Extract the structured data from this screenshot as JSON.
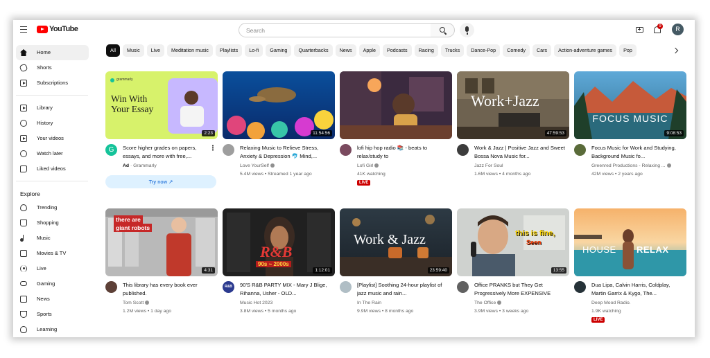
{
  "header": {
    "logo_text": "YouTube",
    "search_placeholder": "Search",
    "notification_count": "9",
    "avatar_letter": "R"
  },
  "sidebar": {
    "primary": [
      {
        "label": "Home",
        "icon": "home-icon",
        "active": true
      },
      {
        "label": "Shorts",
        "icon": "shorts-icon"
      },
      {
        "label": "Subscriptions",
        "icon": "subscriptions-icon"
      }
    ],
    "library": [
      {
        "label": "Library",
        "icon": "library-icon"
      },
      {
        "label": "History",
        "icon": "history-icon"
      },
      {
        "label": "Your videos",
        "icon": "your-videos-icon"
      },
      {
        "label": "Watch later",
        "icon": "watch-later-icon"
      },
      {
        "label": "Liked videos",
        "icon": "liked-videos-icon"
      }
    ],
    "explore_heading": "Explore",
    "explore": [
      {
        "label": "Trending",
        "icon": "trending-icon"
      },
      {
        "label": "Shopping",
        "icon": "shopping-icon"
      },
      {
        "label": "Music",
        "icon": "music-icon"
      },
      {
        "label": "Movies & TV",
        "icon": "movies-icon"
      },
      {
        "label": "Live",
        "icon": "live-icon"
      },
      {
        "label": "Gaming",
        "icon": "gaming-icon"
      },
      {
        "label": "News",
        "icon": "news-icon"
      },
      {
        "label": "Sports",
        "icon": "sports-icon"
      },
      {
        "label": "Learning",
        "icon": "learning-icon"
      }
    ]
  },
  "chips": [
    "All",
    "Music",
    "Live",
    "Meditation music",
    "Playlists",
    "Lo-fi",
    "Gaming",
    "Quarterbacks",
    "News",
    "Apple",
    "Podcasts",
    "Racing",
    "Trucks",
    "Dance-Pop",
    "Comedy",
    "Cars",
    "Action-adventure games",
    "Pop"
  ],
  "videos": [
    {
      "thumb_text": "Win With Your Essay",
      "brand": "grammarly",
      "duration": "2:23",
      "title": "Score higher grades on papers, essays, and more with free,...",
      "ad_label": "Ad",
      "channel": "Grammarly",
      "cta": "Try now",
      "avatar_letter": "G",
      "avatar_color": "#15c39a"
    },
    {
      "duration": "11:54:56",
      "title": "Relaxing Music to Relieve Stress, Anxiety & Depression 🐬 Mind,...",
      "channel": "Love YourSelf",
      "meta": "5.4M views • Streamed 1 year ago"
    },
    {
      "title": "lofi hip hop radio 📚 - beats to relax/study to",
      "channel": "Lofi Girl",
      "meta": "41K watching",
      "live": "LIVE"
    },
    {
      "thumb_text": "Work+Jazz",
      "duration": "47:59:53",
      "title": "Work & Jazz | Positive Jazz and Sweet Bossa Nova Music for...",
      "channel": "Jazz For Soul",
      "meta": "1.6M views • 4 months ago"
    },
    {
      "thumb_text": "FOCUS MUSIC",
      "duration": "9:08:53",
      "title": "Focus Music for Work and Studying, Background Music fo...",
      "channel": "Greenred Productions - Relaxing ...",
      "meta": "42M views • 2 years ago"
    },
    {
      "thumb_text_1": "there are",
      "thumb_text_2": "giant robots",
      "duration": "4:31",
      "title": "This library has every book ever published.",
      "channel": "Tom Scott",
      "meta": "1.2M views • 1 day ago"
    },
    {
      "thumb_text_1": "R&B",
      "thumb_text_2": "90s ~ 2000s",
      "duration": "1:12:01",
      "title": "90'S R&B PARTY MIX - Mary J Blige, Rihanna, Usher - OLD...",
      "channel": "Music Hot 2023",
      "meta": "3.8M views • 5 months ago",
      "avatar_letter": "R&B",
      "avatar_color": "#2b3a8f"
    },
    {
      "thumb_text": "Work & Jazz",
      "duration": "23:59:40",
      "title": "[Playlist] Soothing 24-hour playlist of jazz music and rain...",
      "channel": "In The Rain",
      "meta": "9.9M views • 8 months ago"
    },
    {
      "thumb_text_1": "this is fine,",
      "thumb_text_2": "Seen",
      "duration": "13:55",
      "title": "Office PRANKS but They Get Progressively More EXPENSIVE",
      "channel": "The Office",
      "meta": "3.9M views • 3 weeks ago"
    },
    {
      "thumb_text_1": "HOUSE",
      "thumb_text_2": "RELAX",
      "title": "Dua Lipa, Calvin Harris, Coldplay, Martin Garrix & Kygo, The...",
      "channel": "Deep Mood Radio.",
      "meta": "1.9K watching",
      "live": "LIVE"
    }
  ]
}
